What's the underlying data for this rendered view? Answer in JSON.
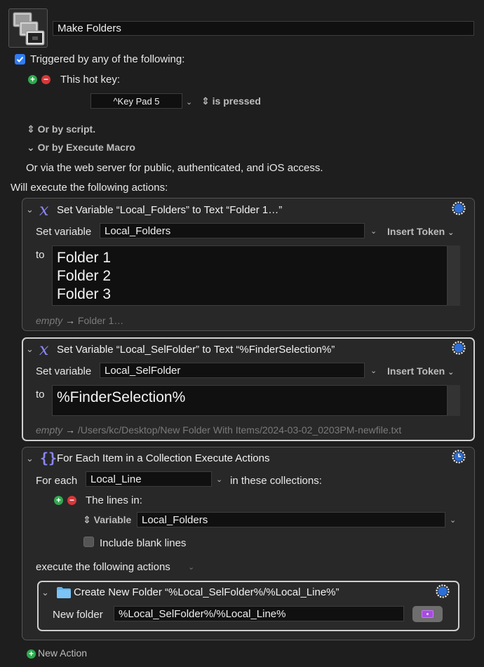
{
  "macro": {
    "name": "Make Folders"
  },
  "trigger": {
    "header": "Triggered by any of the following:",
    "hotkey_label": "This hot key:",
    "hotkey_value": "^Key Pad 5",
    "hotkey_state": "is pressed",
    "or_script": "Or by script.",
    "or_execute": "Or by Execute Macro",
    "web_server": "Or via the web server for public, authenticated, and iOS access."
  },
  "will_execute": "Will execute the following actions:",
  "actions": [
    {
      "title": "Set Variable “Local_Folders” to Text “Folder 1…”",
      "set_label": "Set variable",
      "variable": "Local_Folders",
      "insert_token": "Insert Token",
      "to_label": "to",
      "text_lines": [
        "Folder 1",
        "Folder 2",
        "Folder 3"
      ],
      "result_prefix": "empty",
      "result_arrow": "→",
      "result_value": "Folder 1…"
    },
    {
      "title": "Set Variable “Local_SelFolder” to Text “%FinderSelection%”",
      "set_label": "Set variable",
      "variable": "Local_SelFolder",
      "insert_token": "Insert Token",
      "to_label": "to",
      "text_lines": [
        "%FinderSelection%"
      ],
      "result_prefix": "empty",
      "result_arrow": "→",
      "result_value": "/Users/kc/Desktop/New Folder With Items/2024-03-02_0203PM-newfile.txt"
    },
    {
      "title": "For Each Item in a Collection Execute Actions",
      "for_each_label": "For each",
      "for_each_var": "Local_Line",
      "in_collections": "in these collections:",
      "lines_in": "The lines in:",
      "variable_label": "Variable",
      "variable_value": "Local_Folders",
      "include_blank": "Include blank lines",
      "execute_label": "execute the following actions",
      "sub_action": {
        "title": "Create New Folder “%Local_SelFolder%/%Local_Line%”",
        "new_folder_label": "New folder",
        "new_folder_value": "%Local_SelFolder%/%Local_Line%"
      }
    }
  ],
  "new_action": "New Action",
  "colors": {
    "accent": "#2f7cf6",
    "variable_icon": "#8a86f0",
    "gear": "#2d6fd6",
    "folder": "#5fb4f0",
    "add_green": "#2fa94e",
    "remove_red": "#d6383a"
  },
  "icons": {
    "macro": "macro-group-icon",
    "set_variable": "variable-x-icon",
    "for_each": "braces-icon",
    "folder": "folder-icon",
    "gear": "gear-icon",
    "clock_gear": "gear-clock-icon"
  }
}
